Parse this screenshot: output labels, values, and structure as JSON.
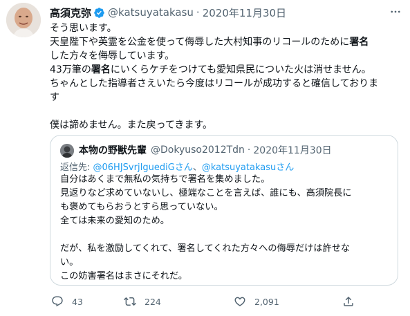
{
  "tweet": {
    "author_name": "高須克弥",
    "handle": "@katsuyatakasu",
    "separator": "·",
    "date": "2020年11月30日",
    "lines": [
      [
        "そう思います。"
      ],
      [
        "天皇陛下や英霊を公金を使って侮辱した大村知事のリコールのために",
        "署名"
      ],
      [
        "した方々を侮辱しています。"
      ],
      [
        "43万筆の",
        "署名",
        "にいくらケチをつけても愛知県民についた火は消せません。"
      ],
      [
        "ちゃんとした指導者さえいたら今度はリコールが成功すると確信しておりま"
      ],
      [
        "す"
      ],
      [
        ""
      ],
      [
        "僕は諦めません。また戻ってきます。"
      ]
    ]
  },
  "quote": {
    "author_name": "本物の野獣先輩",
    "handle": "@Dokyuso2012Tdn",
    "separator": "·",
    "date": "2020年11月30日",
    "reply_prefix": "返信先: ",
    "reply_link_1": "@06HJSvrjIguediGさん",
    "reply_mid": "、",
    "reply_link_2": "@katsuyatakasuさん",
    "lines": [
      "自分はあくまで無私の気持ちで署名を集めました。",
      "見返りなど求めていないし、極端なことを言えば、誰にも、高須院長に",
      "も褒めてもらおうとすら思っていない。",
      "全ては未来の愛知のため。",
      "",
      "だが、私を激励してくれて、署名してくれた方々への侮辱だけは許せな",
      "い。",
      "この妨害署名はまさにそれだ。"
    ]
  },
  "actions": {
    "reply_count": "43",
    "retweet_count": "224",
    "like_count": "2,091"
  },
  "icons": {
    "verified": "verified-badge-icon",
    "more": "more-options-icon",
    "reply": "reply-icon",
    "retweet": "retweet-icon",
    "like": "like-heart-icon",
    "share": "share-icon"
  },
  "colors": {
    "text": "#0f1419",
    "secondary": "#536471",
    "link": "#1d9bf0",
    "border": "#cfd9de",
    "verified": "#1d9bf0"
  }
}
